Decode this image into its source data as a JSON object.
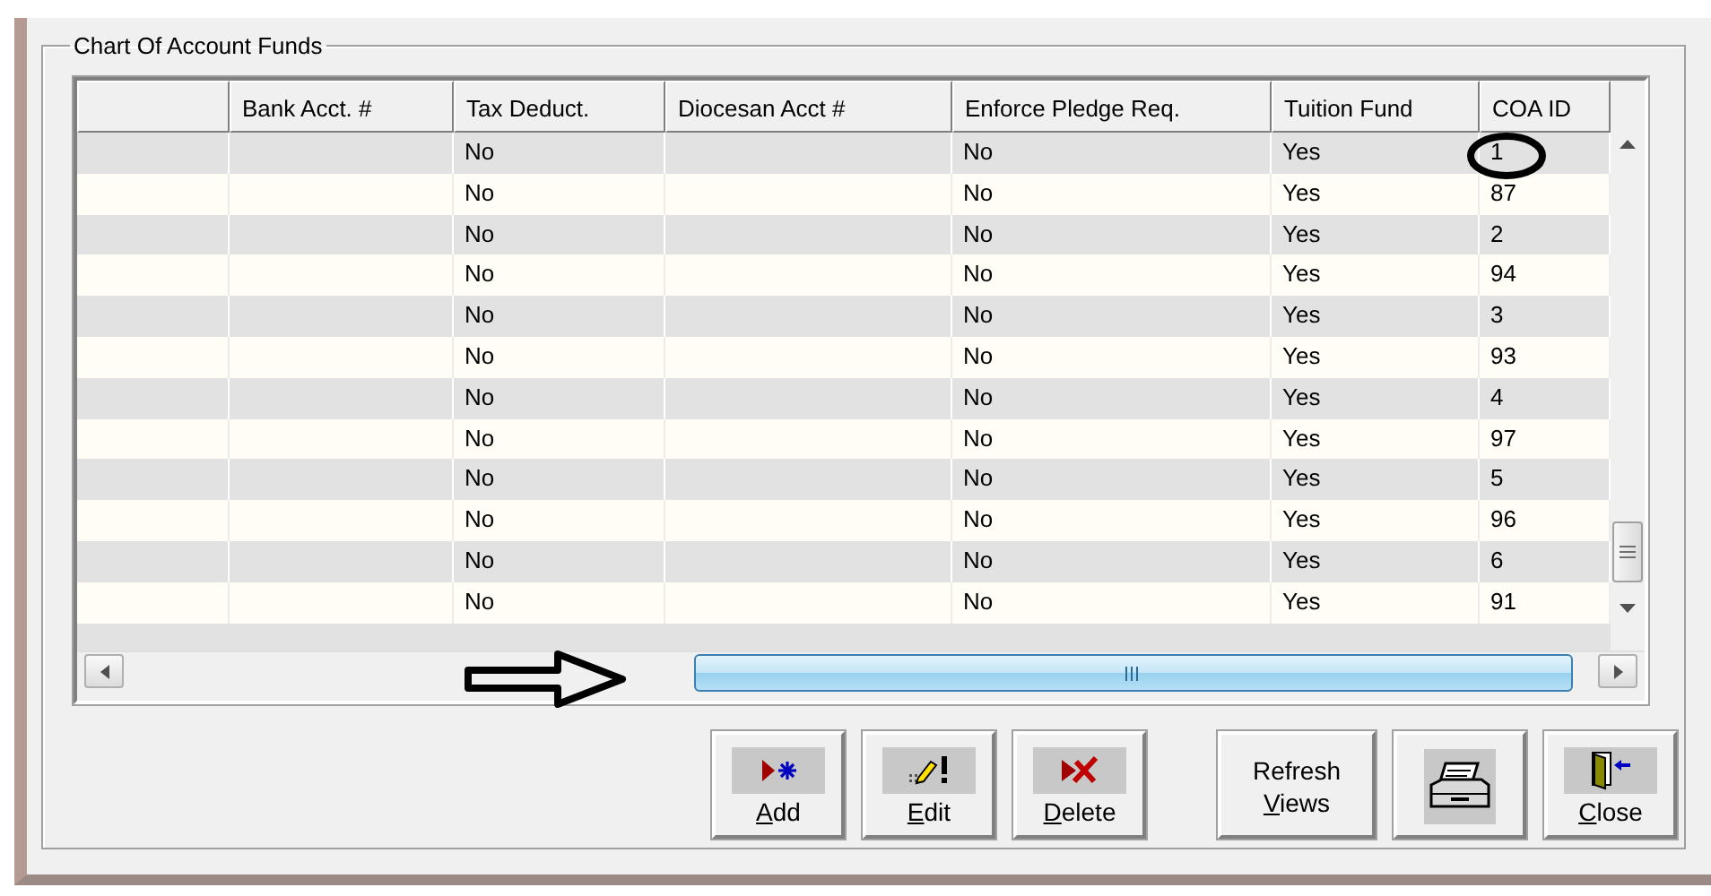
{
  "group": {
    "title": "Chart Of Account Funds"
  },
  "table": {
    "columns": [
      "Bank Acct. #",
      "Tax Deduct.",
      "Diocesan Acct #",
      "Enforce Pledge Req.",
      "Tuition Fund",
      "COA ID"
    ],
    "rows": [
      {
        "tax_deduct": "No",
        "enforce_pledge": "No",
        "tuition_fund": "Yes",
        "coa_id": "1"
      },
      {
        "tax_deduct": "No",
        "enforce_pledge": "No",
        "tuition_fund": "Yes",
        "coa_id": "87"
      },
      {
        "tax_deduct": "No",
        "enforce_pledge": "No",
        "tuition_fund": "Yes",
        "coa_id": "2"
      },
      {
        "tax_deduct": "No",
        "enforce_pledge": "No",
        "tuition_fund": "Yes",
        "coa_id": "94"
      },
      {
        "tax_deduct": "No",
        "enforce_pledge": "No",
        "tuition_fund": "Yes",
        "coa_id": "3"
      },
      {
        "tax_deduct": "No",
        "enforce_pledge": "No",
        "tuition_fund": "Yes",
        "coa_id": "93"
      },
      {
        "tax_deduct": "No",
        "enforce_pledge": "No",
        "tuition_fund": "Yes",
        "coa_id": "4"
      },
      {
        "tax_deduct": "No",
        "enforce_pledge": "No",
        "tuition_fund": "Yes",
        "coa_id": "97"
      },
      {
        "tax_deduct": "No",
        "enforce_pledge": "No",
        "tuition_fund": "Yes",
        "coa_id": "5"
      },
      {
        "tax_deduct": "No",
        "enforce_pledge": "No",
        "tuition_fund": "Yes",
        "coa_id": "96"
      },
      {
        "tax_deduct": "No",
        "enforce_pledge": "No",
        "tuition_fund": "Yes",
        "coa_id": "6"
      },
      {
        "tax_deduct": "No",
        "enforce_pledge": "No",
        "tuition_fund": "Yes",
        "coa_id": "91"
      }
    ]
  },
  "buttons": [
    {
      "kind": "add",
      "lines": [
        "Add"
      ]
    },
    {
      "kind": "edit",
      "lines": [
        "Edit"
      ]
    },
    {
      "kind": "delete",
      "lines": [
        "Delete"
      ]
    },
    {
      "kind": "refresh",
      "lines": [
        "Refresh",
        "Views"
      ]
    },
    {
      "kind": "print"
    },
    {
      "kind": "close",
      "lines": [
        "Close"
      ]
    }
  ]
}
